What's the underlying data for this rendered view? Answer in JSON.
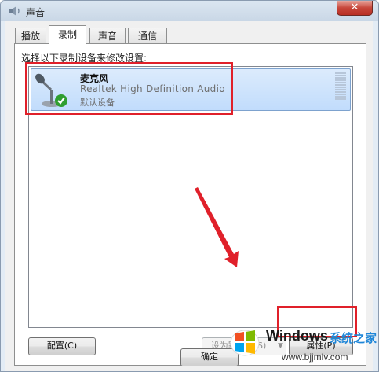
{
  "window": {
    "title": "声音",
    "close_glyph": "✕"
  },
  "tabs": [
    {
      "label": "播放",
      "active": false
    },
    {
      "label": "录制",
      "active": true
    },
    {
      "label": "声音",
      "active": false
    },
    {
      "label": "通信",
      "active": false
    }
  ],
  "recording": {
    "instruction": "选择以下录制设备来修改设置:",
    "devices": [
      {
        "name": "麦克风",
        "description": "Realtek High Definition Audio",
        "status": "默认设备",
        "icon": "microphone-icon",
        "default_badge": "check-icon"
      }
    ]
  },
  "buttons": {
    "configure": "配置(C)",
    "set_default": "设为默认值(S)",
    "set_default_arrow": "▼",
    "properties": "属性(P)",
    "ok": "确定"
  },
  "watermark": {
    "brand": "Windows",
    "cn_text": "系统之家",
    "url": "www.bjjmlv.com"
  },
  "colors": {
    "annotation_red": "#e0202a",
    "selection_blue": "#c1dcfc",
    "close_red": "#c7463a",
    "watermark_blue": "#1e86d8"
  }
}
